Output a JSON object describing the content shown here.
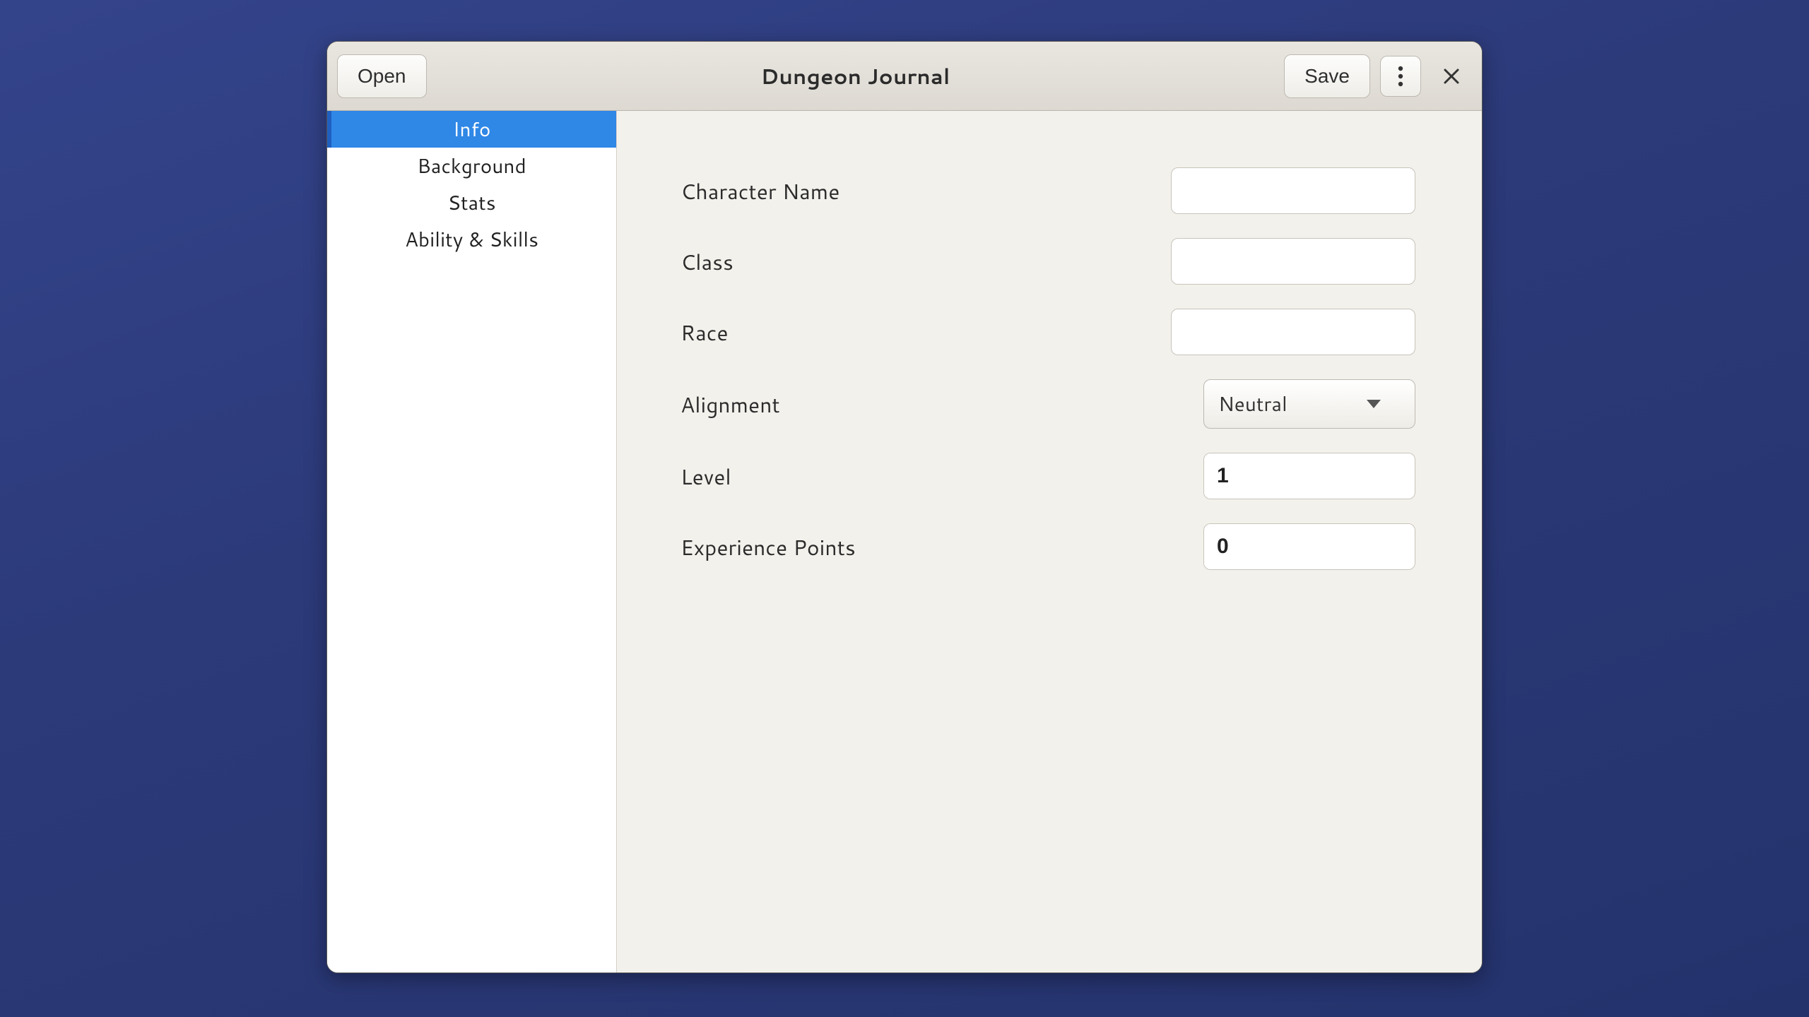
{
  "colors": {
    "accent": "#2f87e6",
    "accent_border": "#1f5fbf"
  },
  "header": {
    "open_label": "Open",
    "title": "Dungeon Journal",
    "save_label": "Save"
  },
  "sidebar": {
    "items": [
      {
        "label": "Info",
        "selected": true
      },
      {
        "label": "Background",
        "selected": false
      },
      {
        "label": "Stats",
        "selected": false
      },
      {
        "label": "Ability & Skills",
        "selected": false
      }
    ]
  },
  "form": {
    "character_name": {
      "label": "Character Name",
      "value": ""
    },
    "class": {
      "label": "Class",
      "value": ""
    },
    "race": {
      "label": "Race",
      "value": ""
    },
    "alignment": {
      "label": "Alignment",
      "value": "Neutral"
    },
    "level": {
      "label": "Level",
      "value": "1"
    },
    "xp": {
      "label": "Experience Points",
      "value": "0"
    }
  }
}
